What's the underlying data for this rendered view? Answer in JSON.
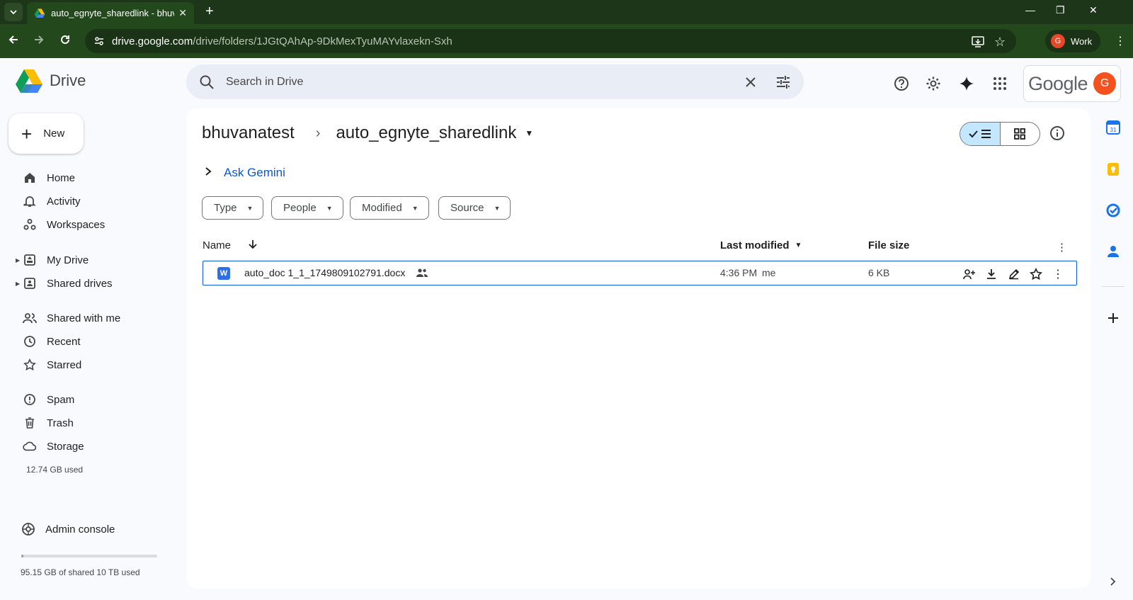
{
  "browser": {
    "tab_title": "auto_egnyte_sharedlink - bhuva",
    "url_host": "drive.google.com",
    "url_path": "/drive/folders/1JGtQAhAp-9DkMexTyuMAYvlaxekn-Sxh",
    "profile_label": "Work",
    "profile_initial": "G"
  },
  "app": {
    "name": "Drive",
    "search_placeholder": "Search in Drive",
    "google_word": "Google",
    "account_initial": "G"
  },
  "sidebar": {
    "new_label": "New",
    "items": [
      {
        "label": "Home",
        "icon": "home-icon"
      },
      {
        "label": "Activity",
        "icon": "bell-icon"
      },
      {
        "label": "Workspaces",
        "icon": "workspaces-icon"
      },
      {
        "label": "My Drive",
        "icon": "my-drive-icon"
      },
      {
        "label": "Shared drives",
        "icon": "shared-drives-icon"
      },
      {
        "label": "Shared with me",
        "icon": "people-icon"
      },
      {
        "label": "Recent",
        "icon": "clock-icon"
      },
      {
        "label": "Starred",
        "icon": "star-icon"
      },
      {
        "label": "Spam",
        "icon": "spam-icon"
      },
      {
        "label": "Trash",
        "icon": "trash-icon"
      },
      {
        "label": "Storage",
        "icon": "cloud-icon"
      }
    ],
    "storage_used": "12.74 GB used",
    "admin_label": "Admin console",
    "quota_text": "95.15 GB of shared 10 TB used",
    "quota_fraction": 0.0095
  },
  "main": {
    "breadcrumb_parent": "bhuvanatest",
    "breadcrumb_current": "auto_egnyte_sharedlink",
    "ask_gemini": "Ask Gemini",
    "filters": [
      "Type",
      "People",
      "Modified",
      "Source"
    ],
    "columns": {
      "name": "Name",
      "last_modified": "Last modified",
      "file_size": "File size"
    },
    "files": [
      {
        "name": "auto_doc 1_1_1749809102791.docx",
        "modified": "4:36 PM",
        "modified_by": "me",
        "size": "6 KB",
        "type_letter": "W"
      }
    ]
  },
  "colors": {
    "accent": "#0b57d0",
    "toggle_selected": "#c2e7ff",
    "browser_frame": "#23481c"
  }
}
